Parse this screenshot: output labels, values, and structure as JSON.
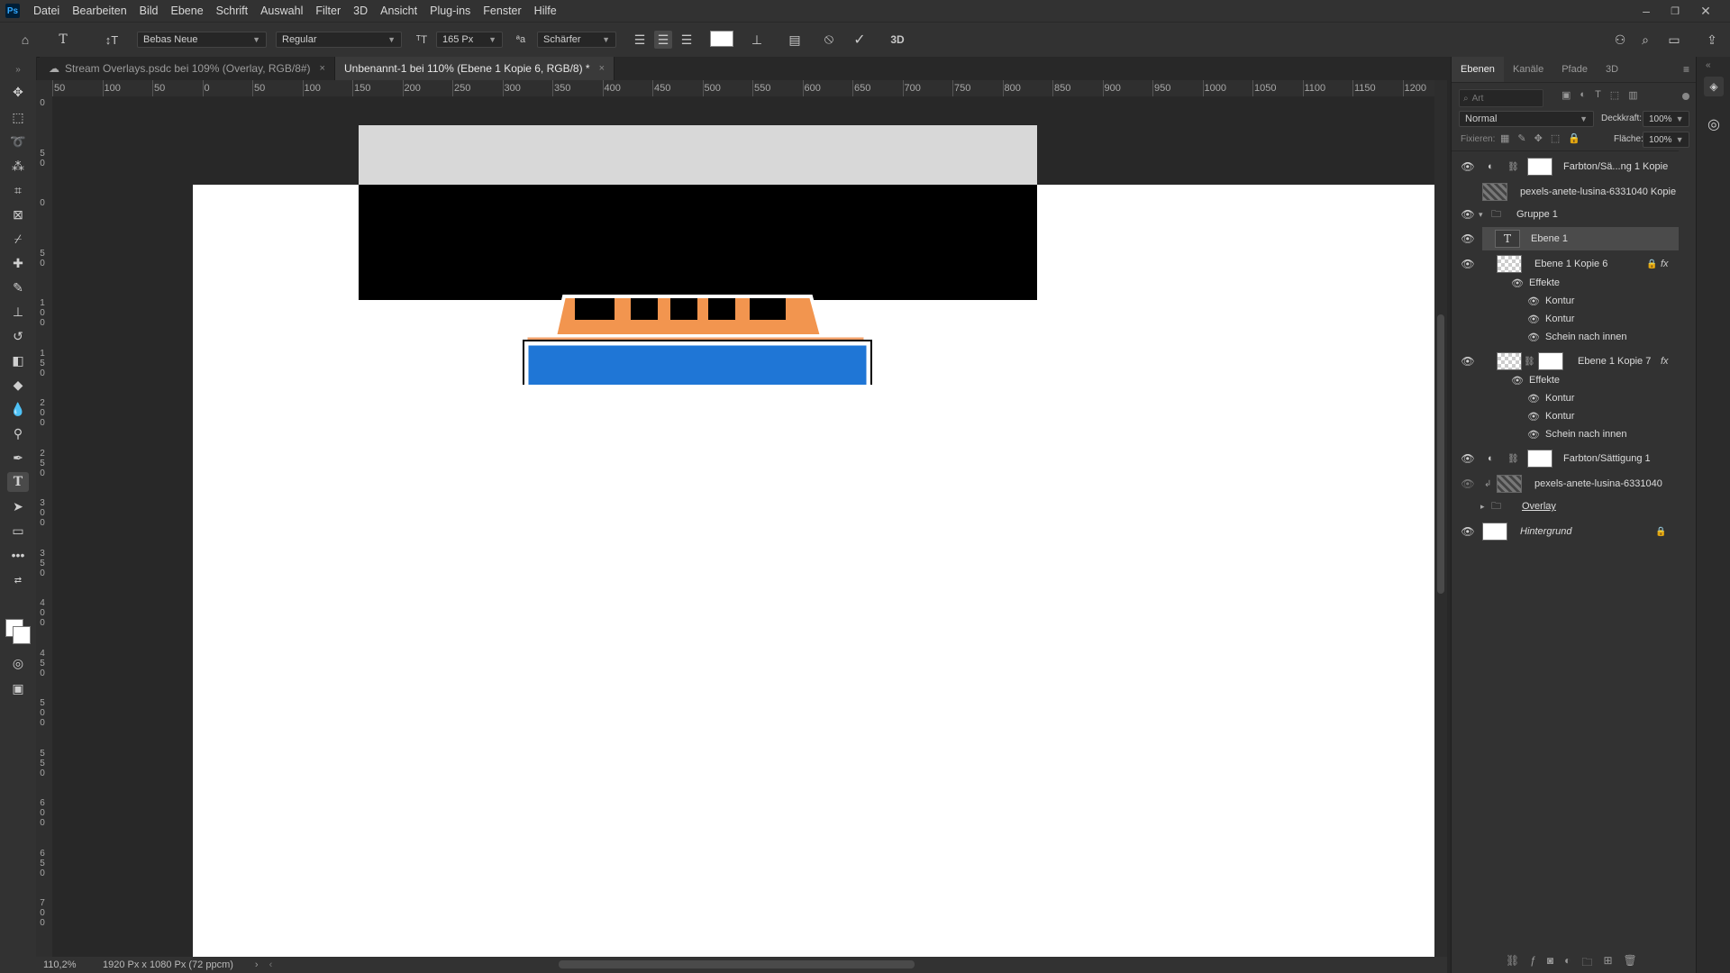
{
  "menubar": {
    "logo": "Ps",
    "items": [
      "Datei",
      "Bearbeiten",
      "Bild",
      "Ebene",
      "Schrift",
      "Auswahl",
      "Filter",
      "3D",
      "Ansicht",
      "Plug-ins",
      "Fenster",
      "Hilfe"
    ]
  },
  "options": {
    "font_family": "Bebas Neue",
    "font_style": "Regular",
    "font_size": "165 Px",
    "antialias": "Schärfer",
    "threed_label": "3D"
  },
  "tabs": [
    {
      "label": "Stream Overlays.psdc bei 109% (Overlay, RGB/8#)",
      "close": "×"
    },
    {
      "label": "Unbenannt-1 bei 110% (Ebene 1 Kopie 6, RGB/8) *",
      "close": "×"
    }
  ],
  "ruler": {
    "h_labels": [
      "50",
      "100",
      "50",
      "0",
      "50",
      "100",
      "150",
      "200",
      "250",
      "300",
      "350",
      "400",
      "450",
      "500",
      "550",
      "600",
      "650",
      "700",
      "750",
      "800",
      "850",
      "900",
      "950",
      "1000",
      "1050",
      "1100",
      "1150",
      "1200"
    ],
    "v_labels": [
      "0",
      "50",
      "0",
      "50",
      "100",
      "150",
      "200",
      "250",
      "300",
      "350",
      "400",
      "450",
      "500",
      "550",
      "600",
      "650",
      "700"
    ]
  },
  "status": {
    "zoom": "110,2%",
    "doc_info": "1920 Px x 1080 Px (72 ppcm)"
  },
  "layers_panel": {
    "tabs": [
      "Ebenen",
      "Kanäle",
      "Pfade",
      "3D"
    ],
    "search_placeholder": "Art",
    "blend_mode": "Normal",
    "opacity_label": "Deckkraft:",
    "opacity_value": "100%",
    "lock_label": "Fixieren:",
    "fill_label": "Fläche:",
    "fill_value": "100%",
    "layers": [
      {
        "name": "Farbton/Sä...ng 1 Kopie"
      },
      {
        "name": "pexels-anete-lusina-6331040 Kopie"
      },
      {
        "name": "Gruppe 1"
      },
      {
        "name": "Ebene 1"
      },
      {
        "name": "Ebene 1 Kopie 6"
      },
      {
        "name": "Effekte"
      },
      {
        "name": "Kontur"
      },
      {
        "name": "Kontur"
      },
      {
        "name": "Schein nach innen"
      },
      {
        "name": "Ebene 1 Kopie 7"
      },
      {
        "name": "Effekte"
      },
      {
        "name": "Kontur"
      },
      {
        "name": "Kontur"
      },
      {
        "name": "Schein nach innen"
      },
      {
        "name": "Farbton/Sättigung 1"
      },
      {
        "name": "pexels-anete-lusina-6331040"
      },
      {
        "name": "Overlay"
      },
      {
        "name": "Hintergrund"
      }
    ],
    "fx_label": "fx"
  },
  "colors": {
    "canvas_black": "#000000",
    "orange": "#f2954f",
    "blue": "#1f76d6",
    "gray_band": "#d8d8d8"
  }
}
